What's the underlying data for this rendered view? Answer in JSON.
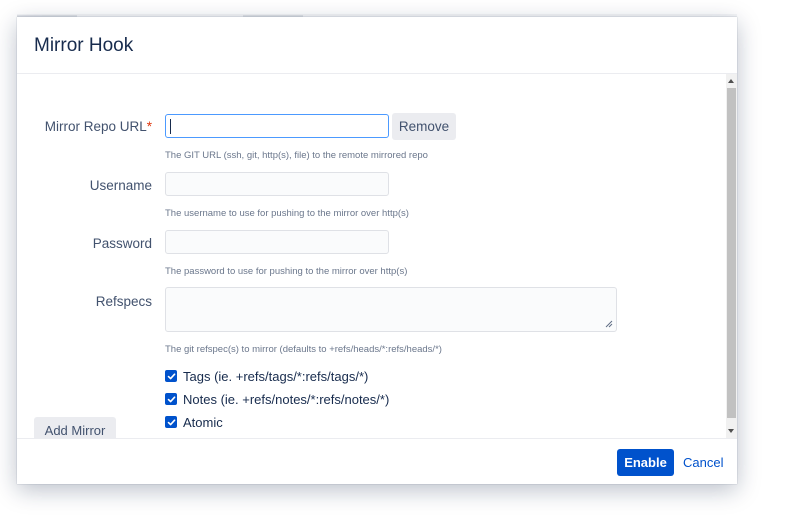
{
  "dialog": {
    "title": "Mirror Hook"
  },
  "form": {
    "mirror_url": {
      "label": "Mirror Repo URL",
      "required_mark": "*",
      "value": "",
      "description": "The GIT URL (ssh, git, http(s), file) to the remote mirrored repo",
      "remove_label": "Remove"
    },
    "username": {
      "label": "Username",
      "value": "",
      "description": "The username to use for pushing to the mirror over http(s)"
    },
    "password": {
      "label": "Password",
      "value": "",
      "description": "The password to use for pushing to the mirror over http(s)"
    },
    "refspecs": {
      "label": "Refspecs",
      "value": "",
      "description": "The git refspec(s) to mirror (defaults to +refs/heads/*:refs/heads/*)"
    },
    "checkboxes": [
      {
        "label": "Tags (ie. +refs/tags/*:refs/tags/*)",
        "checked": true
      },
      {
        "label": "Notes (ie. +refs/notes/*:refs/notes/*)",
        "checked": true
      },
      {
        "label": "Atomic",
        "checked": true
      }
    ],
    "add_mirror_label": "Add Mirror"
  },
  "footer": {
    "enable_label": "Enable",
    "cancel_label": "Cancel"
  },
  "colors": {
    "primary": "#0052cc",
    "required": "#de350b",
    "focus_border": "#4c9aff"
  }
}
